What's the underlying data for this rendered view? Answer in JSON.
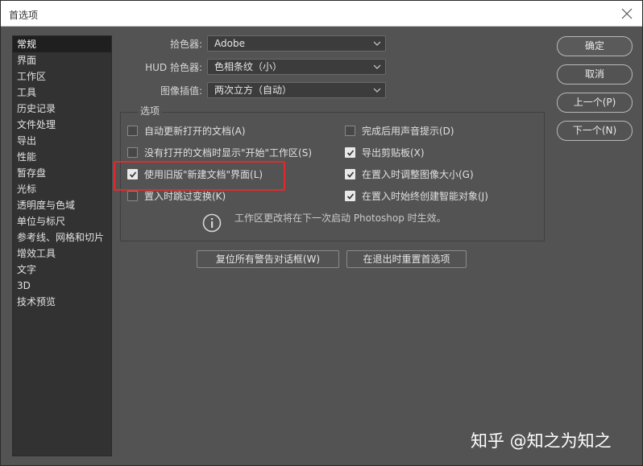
{
  "window": {
    "title": "首选项"
  },
  "sidebar": {
    "items": [
      {
        "label": "常规",
        "active": true
      },
      {
        "label": "界面"
      },
      {
        "label": "工作区"
      },
      {
        "label": "工具"
      },
      {
        "label": "历史记录"
      },
      {
        "label": "文件处理"
      },
      {
        "label": "导出"
      },
      {
        "label": "性能"
      },
      {
        "label": "暂存盘"
      },
      {
        "label": "光标"
      },
      {
        "label": "透明度与色域"
      },
      {
        "label": "单位与标尺"
      },
      {
        "label": "参考线、网格和切片"
      },
      {
        "label": "增效工具"
      },
      {
        "label": "文字"
      },
      {
        "label": "3D"
      },
      {
        "label": "技术预览"
      }
    ]
  },
  "general": {
    "color_picker": {
      "label": "拾色器:",
      "value": "Adobe"
    },
    "hud_color_picker": {
      "label": "HUD 拾色器:",
      "value": "色相条纹（小）"
    },
    "image_interpolation": {
      "label": "图像插值:",
      "value": "两次立方（自动）"
    }
  },
  "options": {
    "title": "选项",
    "left": [
      {
        "label": "自动更新打开的文档(A)",
        "checked": false
      },
      {
        "label": "没有打开的文档时显示\"开始\"工作区(S)",
        "checked": false
      },
      {
        "label": "使用旧版\"新建文档\"界面(L)",
        "checked": true
      },
      {
        "label": "置入时跳过变换(K)",
        "checked": false
      }
    ],
    "right": [
      {
        "label": "完成后用声音提示(D)",
        "checked": false
      },
      {
        "label": "导出剪贴板(X)",
        "checked": true
      },
      {
        "label": "在置入时调整图像大小(G)",
        "checked": true
      },
      {
        "label": "在置入时始终创建智能对象(J)",
        "checked": true
      }
    ],
    "info": "工作区更改将在下一次启动 Photoshop 时生效。"
  },
  "actions": {
    "reset_warnings": "复位所有警告对话框(W)",
    "reset_on_quit": "在退出时重置首选项"
  },
  "buttons": {
    "ok": "确定",
    "cancel": "取消",
    "prev": "上一个(P)",
    "next": "下一个(N)"
  },
  "watermark": "知乎 @知之为知之",
  "colors": {
    "highlight": "#e12b2b",
    "panel": "#535353",
    "sidebar": "#323232"
  }
}
